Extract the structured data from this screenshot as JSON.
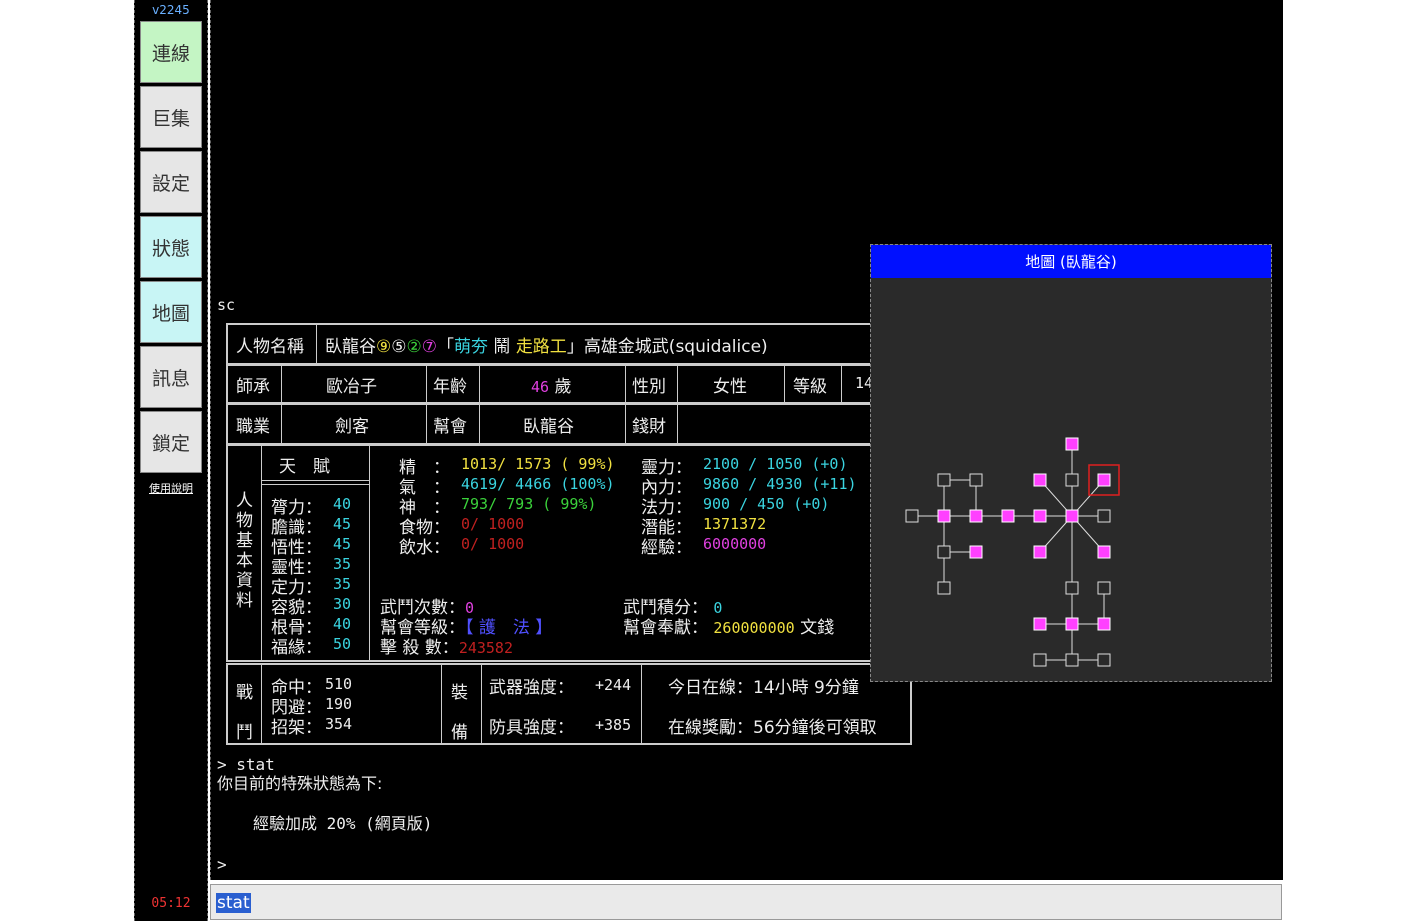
{
  "sidebar": {
    "version": "v2245",
    "buttons": [
      "連線",
      "巨集",
      "設定",
      "狀態",
      "地圖",
      "訊息",
      "鎖定"
    ],
    "help_link": "使用說明",
    "clock": "05:12"
  },
  "terminal": {
    "prev_command": "sc",
    "profile": {
      "name_label": "人物名稱",
      "name_prefix": "臥龍谷",
      "name_circled": [
        "⑨",
        "⑤",
        "②",
        "⑦"
      ],
      "title_open": "「",
      "title_a": "萌夯",
      "title_b": "鬧",
      "title_c": "走路工",
      "title_close": "」",
      "name_suffix": "高雄金城武(squidalice)",
      "master_label": "師承",
      "master": "歐冶子",
      "age_label": "年齡",
      "age_num": "46",
      "age_unit": "歲",
      "gender_label": "性別",
      "gender": "女性",
      "level_label": "等級",
      "level": "14",
      "job_label": "職業",
      "job": "劍客",
      "guild_label": "幫會",
      "guild": "臥龍谷",
      "money_label": "錢財",
      "basic_label": [
        "人",
        "物",
        "基",
        "本",
        "資",
        "料"
      ],
      "talent_label": "天　賦",
      "attrs": [
        {
          "label": "膂力：",
          "val": "40"
        },
        {
          "label": "膽識：",
          "val": "45"
        },
        {
          "label": "悟性：",
          "val": "45"
        },
        {
          "label": "靈性：",
          "val": "35"
        },
        {
          "label": "定力：",
          "val": "35"
        },
        {
          "label": "容貌：",
          "val": "30"
        },
        {
          "label": "根骨：",
          "val": "40"
        },
        {
          "label": "福緣：",
          "val": "50"
        }
      ],
      "stats_left": [
        {
          "label": "精　：",
          "val": "1013/ 1573 ( 99%)"
        },
        {
          "label": "氣　：",
          "val": "4619/ 4466 (100%)"
        },
        {
          "label": "神　：",
          "val": " 793/  793 ( 99%)"
        },
        {
          "label": "食物：",
          "val": "  0/ 1000"
        },
        {
          "label": "飲水：",
          "val": "  0/ 1000"
        }
      ],
      "stats_right": [
        {
          "label": "靈力：",
          "val": "2100 / 1050 (+0)"
        },
        {
          "label": "內力：",
          "val": "9860 / 4930 (+11)"
        },
        {
          "label": "法力：",
          "val": " 900 /  450 (+0)"
        },
        {
          "label": "潛能：",
          "val": "1371372"
        },
        {
          "label": "經驗：",
          "val": "6000000"
        }
      ],
      "duel_count_label": "武鬥次數：",
      "duel_count": "0",
      "duel_score_label": "武鬥積分：",
      "duel_score": "0",
      "guild_rank_label": "幫會等級：",
      "guild_rank": "【 護　法 】",
      "guild_contrib_label": "幫會奉獻：",
      "guild_contrib": "260000000",
      "guild_contrib_unit": "文錢",
      "kills_label": "擊 殺 數：",
      "kills": "243582",
      "battle_label": [
        "戰",
        "鬥"
      ],
      "battle": [
        {
          "label": "命中：",
          "val": "510"
        },
        {
          "label": "閃避：",
          "val": "190"
        },
        {
          "label": "招架：",
          "val": "354"
        }
      ],
      "equip_label": [
        "裝",
        "備"
      ],
      "weapon_label": "武器強度：",
      "weapon": "+244",
      "armor_label": "防具強度：",
      "armor": "+385",
      "online_today": "今日在線：14小時 9分鐘",
      "online_reward": "在線獎勵：56分鐘後可領取"
    },
    "cmd_line": "> stat",
    "status_header": "你目前的特殊狀態為下:",
    "status_item": "經驗加成 20% (網頁版)",
    "prompt": ">"
  },
  "input": {
    "value": "stat"
  },
  "map": {
    "title": "地圖 (臥龍谷)"
  },
  "colors": {
    "accent_blue": "#0010ff",
    "map_room": "#ff40ff",
    "current_room_marker": "#e02020"
  }
}
